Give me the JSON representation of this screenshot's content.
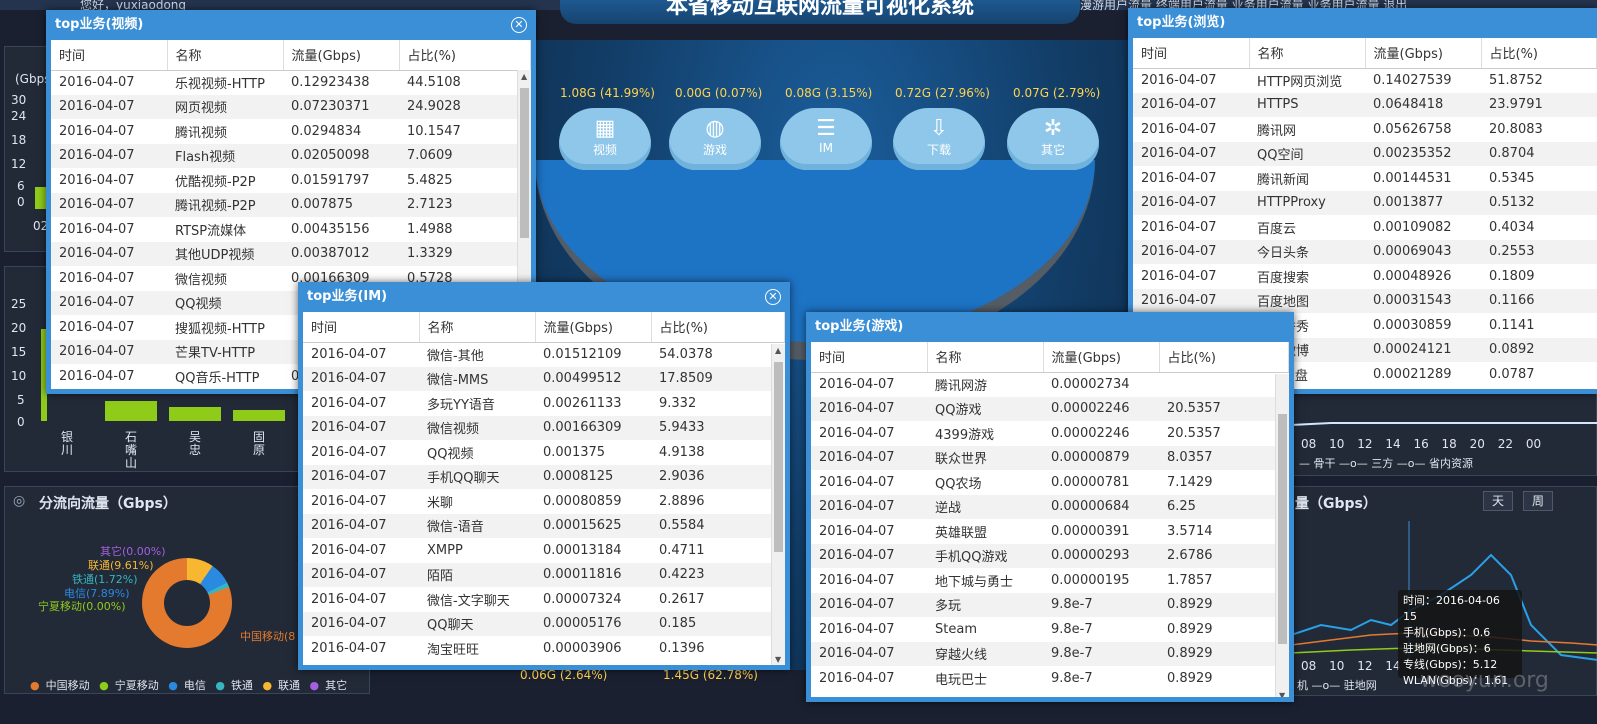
{
  "header": {
    "system_title": "本省移动互联网流量可视化系统",
    "greeting": "您好，yuxiaodong",
    "top_links": "漫游用户流量   终端用户流量   业务用户流量   业务用户流量   退出"
  },
  "center": {
    "categories": [
      {
        "value": "1.08G (41.99%)",
        "label": "视频",
        "icon": "film-icon"
      },
      {
        "value": "0.00G (0.07%)",
        "label": "游戏",
        "icon": "globe-icon"
      },
      {
        "value": "0.08G (3.15%)",
        "label": "IM",
        "icon": "database-icon"
      },
      {
        "value": "0.72G (27.96%)",
        "label": "下载",
        "icon": "download-cloud-icon"
      },
      {
        "value": "0.07G (2.79%)",
        "label": "其它",
        "icon": "share-icon"
      }
    ],
    "bottom_values": [
      "0.06G (2.64%)",
      "1.45G (62.78%)"
    ]
  },
  "left_panels": {
    "top_chart": {
      "ylabel": "(Gbps)",
      "yticks": [
        "30",
        "24",
        "18",
        "12",
        "6",
        "0"
      ],
      "xtick": "02"
    },
    "bar_chart": {
      "yticks": [
        "25",
        "20",
        "15",
        "10",
        "5",
        "0"
      ],
      "categories": [
        "银川",
        "石嘴山",
        "吴忠",
        "固原"
      ]
    },
    "direction": {
      "title": "分流向流量（Gbps）",
      "labels": [
        "其它(0.00%)",
        "联通(9.61%)",
        "铁通(1.72%)",
        "电信(7.89%)",
        "宁夏移动(0.00%)",
        "中国移动(8"
      ],
      "legend": [
        "中国移动",
        "宁夏移动",
        "电信",
        "铁通",
        "联通",
        "其它"
      ]
    }
  },
  "right_panels": {
    "xticks": [
      "08",
      "10",
      "12",
      "14",
      "16",
      "18",
      "20",
      "22",
      "00"
    ],
    "legend": "— 骨干  —o— 三方  —o— 省内资源",
    "bottom_title": "量（Gbps）",
    "btn_day": "天",
    "btn_week": "周",
    "xticks2": [
      "08",
      "10",
      "12",
      "14",
      "16",
      "18",
      "20",
      "22",
      "00"
    ],
    "legend2": "机  —o— 驻地网",
    "tooltip": [
      "时间：2016-04-06 15",
      "手机(Gbps)：0.6",
      "驻地网(Gbps)：6",
      "专线(Gbps)：5.12",
      "WLAN(Gbps)：1.61"
    ]
  },
  "columns": [
    "时间",
    "名称",
    "流量(Gbps)",
    "占比(%)"
  ],
  "windows": {
    "video": {
      "title": "top业务(视频)",
      "rows": [
        [
          "2016-04-07",
          "乐视视频-HTTP",
          "0.12923438",
          "44.5108"
        ],
        [
          "2016-04-07",
          "网页视频",
          "0.07230371",
          "24.9028"
        ],
        [
          "2016-04-07",
          "腾讯视频",
          "0.0294834",
          "10.1547"
        ],
        [
          "2016-04-07",
          "Flash视频",
          "0.02050098",
          "7.0609"
        ],
        [
          "2016-04-07",
          "优酷视频-P2P",
          "0.01591797",
          "5.4825"
        ],
        [
          "2016-04-07",
          "腾讯视频-P2P",
          "0.007875",
          "2.7123"
        ],
        [
          "2016-04-07",
          "RTSP流媒体",
          "0.00435156",
          "1.4988"
        ],
        [
          "2016-04-07",
          "其他UDP视频",
          "0.00387012",
          "1.3329"
        ],
        [
          "2016-04-07",
          "微信视频",
          "0.00166309",
          "0.5728"
        ],
        [
          "2016-04-07",
          "QQ视频",
          "",
          ""
        ],
        [
          "2016-04-07",
          "搜狐视频-HTTP",
          "",
          ""
        ],
        [
          "2016-04-07",
          "芒果TV-HTTP",
          "",
          ""
        ],
        [
          "2016-04-07",
          "QQ音乐-HTTP",
          "0",
          ""
        ]
      ]
    },
    "im": {
      "title": "top业务(IM)",
      "rows": [
        [
          "2016-04-07",
          "微信-其他",
          "0.01512109",
          "54.0378"
        ],
        [
          "2016-04-07",
          "微信-MMS",
          "0.00499512",
          "17.8509"
        ],
        [
          "2016-04-07",
          "多玩YY语音",
          "0.00261133",
          "9.332"
        ],
        [
          "2016-04-07",
          "微信视频",
          "0.00166309",
          "5.9433"
        ],
        [
          "2016-04-07",
          "QQ视频",
          "0.001375",
          "4.9138"
        ],
        [
          "2016-04-07",
          "手机QQ聊天",
          "0.0008125",
          "2.9036"
        ],
        [
          "2016-04-07",
          "米聊",
          "0.00080859",
          "2.8896"
        ],
        [
          "2016-04-07",
          "微信-语音",
          "0.00015625",
          "0.5584"
        ],
        [
          "2016-04-07",
          "XMPP",
          "0.00013184",
          "0.4711"
        ],
        [
          "2016-04-07",
          "陌陌",
          "0.00011816",
          "0.4223"
        ],
        [
          "2016-04-07",
          "微信-文字聊天",
          "0.00007324",
          "0.2617"
        ],
        [
          "2016-04-07",
          "QQ聊天",
          "0.00005176",
          "0.185"
        ],
        [
          "2016-04-07",
          "淘宝旺旺",
          "0.00003906",
          "0.1396"
        ]
      ]
    },
    "game": {
      "title": "top业务(游戏)",
      "rows": [
        [
          "2016-04-07",
          "腾讯网游",
          "0.00002734",
          ""
        ],
        [
          "2016-04-07",
          "QQ游戏",
          "0.00002246",
          "20.5357"
        ],
        [
          "2016-04-07",
          "4399游戏",
          "0.00002246",
          "20.5357"
        ],
        [
          "2016-04-07",
          "联众世界",
          "0.00000879",
          "8.0357"
        ],
        [
          "2016-04-07",
          "QQ农场",
          "0.00000781",
          "7.1429"
        ],
        [
          "2016-04-07",
          "逆战",
          "0.00000684",
          "6.25"
        ],
        [
          "2016-04-07",
          "英雄联盟",
          "0.00000391",
          "3.5714"
        ],
        [
          "2016-04-07",
          "手机QQ游戏",
          "0.00000293",
          "2.6786"
        ],
        [
          "2016-04-07",
          "地下城与勇士",
          "0.00000195",
          "1.7857"
        ],
        [
          "2016-04-07",
          "多玩",
          "9.8e-7",
          "0.8929"
        ],
        [
          "2016-04-07",
          "Steam",
          "9.8e-7",
          "0.8929"
        ],
        [
          "2016-04-07",
          "穿越火线",
          "9.8e-7",
          "0.8929"
        ],
        [
          "2016-04-07",
          "电玩巴士",
          "9.8e-7",
          "0.8929"
        ]
      ]
    },
    "browse": {
      "title": "top业务(浏览)",
      "rows": [
        [
          "2016-04-07",
          "HTTP网页浏览",
          "0.14027539",
          "51.8752"
        ],
        [
          "2016-04-07",
          "HTTPS",
          "0.0648418",
          "23.9791"
        ],
        [
          "2016-04-07",
          "腾讯网",
          "0.05626758",
          "20.8083"
        ],
        [
          "2016-04-07",
          "QQ空间",
          "0.00235352",
          "0.8704"
        ],
        [
          "2016-04-07",
          "腾讯新闻",
          "0.00144531",
          "0.5345"
        ],
        [
          "2016-04-07",
          "HTTPProxy",
          "0.0013877",
          "0.5132"
        ],
        [
          "2016-04-07",
          "百度云",
          "0.00109082",
          "0.4034"
        ],
        [
          "2016-04-07",
          "今日头条",
          "0.00069043",
          "0.2553"
        ],
        [
          "2016-04-07",
          "百度搜索",
          "0.00048926",
          "0.1809"
        ],
        [
          "2016-04-07",
          "百度地图",
          "0.00031543",
          "0.1166"
        ],
        [
          "2016-04-07",
          "美图秀秀",
          "0.00030859",
          "0.1141"
        ],
        [
          "2016-04-07",
          "新浪微博",
          "0.00024121",
          "0.0892"
        ],
        [
          "2016-04-07",
          "115网盘",
          "0.00021289",
          "0.0787"
        ]
      ]
    }
  },
  "watermark": "wooyun.org"
}
